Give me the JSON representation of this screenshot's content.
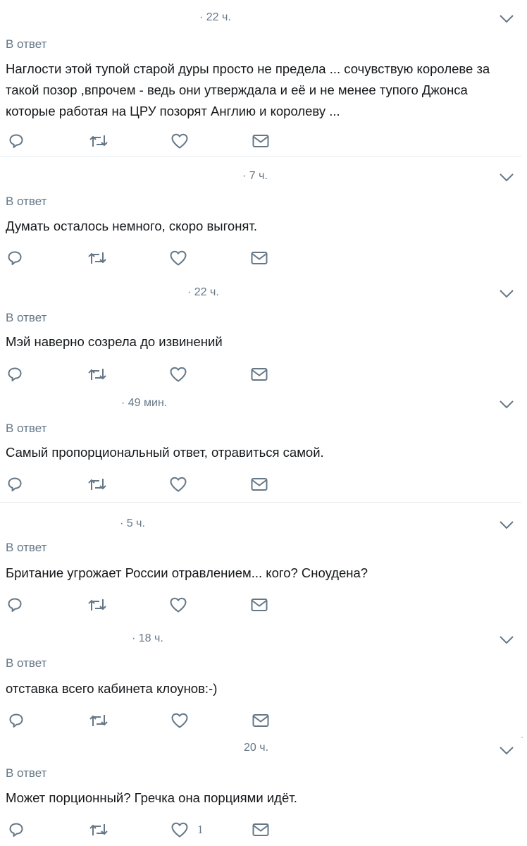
{
  "tweets": [
    {
      "time": "· 22 ч.",
      "reply_label": "В ответ",
      "text": "Наглости этой тупой старой  дуры просто не предела ... сочувствую королеве за такой позор ,впрочем - ведь они утверждала и её и не менее тупого Джонса которые работая на ЦРУ позорят Англию и королеву ...",
      "likes": ""
    },
    {
      "time": "· 7 ч.",
      "reply_label": "В ответ",
      "text": "Думать осталось немного, скоро выгонят.",
      "likes": ""
    },
    {
      "time": "· 22 ч.",
      "reply_label": "В ответ",
      "text": "Мэй наверно созрела до извинений",
      "likes": ""
    },
    {
      "time": "· 49 мин.",
      "reply_label": "В ответ",
      "text": "Самый пропорциональный ответ, отравиться самой.",
      "likes": ""
    },
    {
      "time": "· 5 ч.",
      "reply_label": "В ответ",
      "text": "Британие угрожает России отравлением... кого? Сноудена?",
      "likes": ""
    },
    {
      "time": "· 18 ч.",
      "reply_label": "В ответ",
      "text": "отставка всего кабинета клоунов:-)",
      "likes": ""
    },
    {
      "time": "20 ч.",
      "reply_label": "В ответ",
      "text": "Может порционный? Гречка она порциями идёт.",
      "likes": "1"
    }
  ],
  "icons": {
    "reply": "reply-icon",
    "retweet": "retweet-icon",
    "like": "heart-icon",
    "message": "envelope-icon",
    "more": "chevron-down-icon"
  },
  "colors": {
    "icon": "#657786",
    "text": "#14171a",
    "secondary": "#657786",
    "divider": "#e6ecf0"
  }
}
